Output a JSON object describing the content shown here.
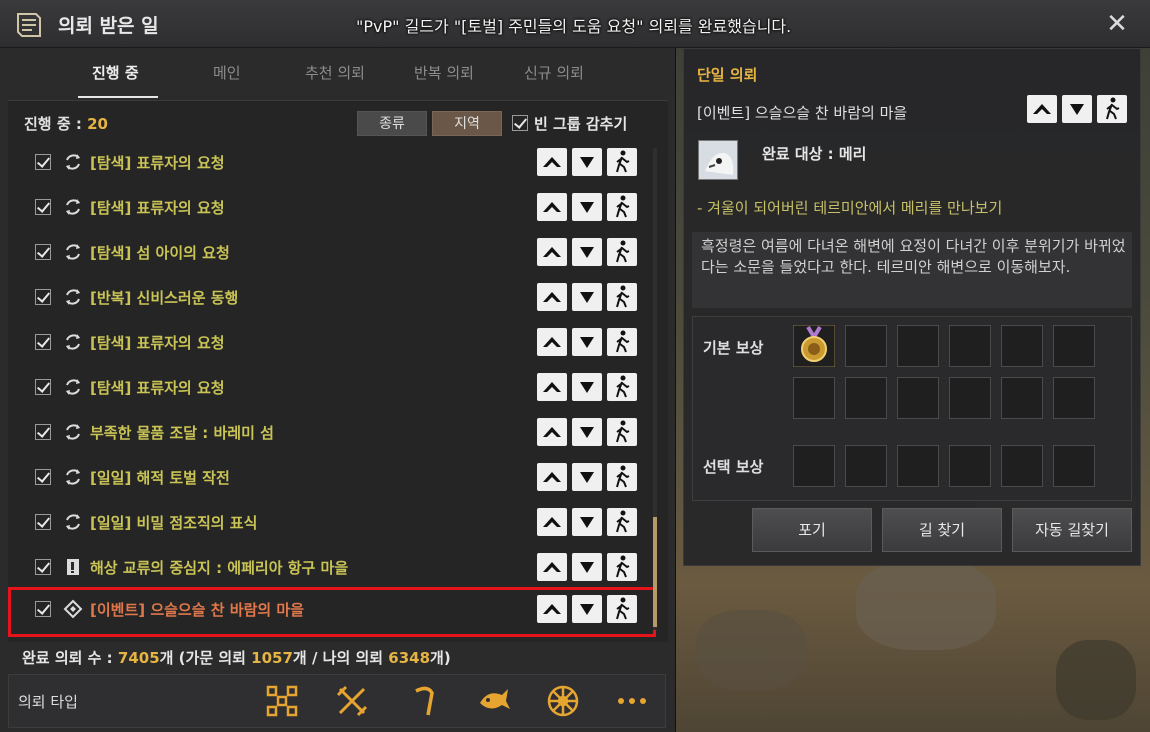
{
  "window": {
    "title": "의뢰 받은 일",
    "notice": "\"PvP\" 길드가 \"[토벌] 주민들의 도움 요청\" 의뢰를 완료했습니다."
  },
  "tabs": [
    {
      "label": "진행 중",
      "active": true
    },
    {
      "label": "메인"
    },
    {
      "label": "추천 의뢰"
    },
    {
      "label": "반복 의뢰"
    },
    {
      "label": "신규 의뢰"
    }
  ],
  "filters": {
    "count_label": "진행 중 : ",
    "count_value": "20",
    "kind_label": "종류",
    "region_label": "지역",
    "hide_empty_label": "빈 그룹 감추기"
  },
  "quests": [
    {
      "name": "[탐색] 표류자의 요청",
      "icon": "repeat-icon"
    },
    {
      "name": "[탐색] 표류자의 요청",
      "icon": "repeat-icon"
    },
    {
      "name": "[탐색] 섬 아이의 요청",
      "icon": "repeat-icon"
    },
    {
      "name": "[반복] 신비스러운 동행",
      "icon": "repeat-icon"
    },
    {
      "name": "[탐색] 표류자의 요청",
      "icon": "repeat-icon"
    },
    {
      "name": "[탐색] 표류자의 요청",
      "icon": "repeat-icon"
    },
    {
      "name": "부족한 물품 조달 : 바레미 섬",
      "icon": "repeat-icon"
    },
    {
      "name": "[일일] 해적 토벌 작전",
      "icon": "repeat-icon"
    },
    {
      "name": "[일일] 비밀 점조직의 표식",
      "icon": "repeat-icon"
    },
    {
      "name": "해상 교류의 중심지 : 에페리아 항구 마을",
      "icon": "scroll-icon"
    },
    {
      "name": "[이벤트] 으슬으슬 찬 바람의 마을",
      "icon": "diamond-icon",
      "event": true
    }
  ],
  "summary": {
    "prefix": "완료 의뢰 수 : ",
    "total": "7405",
    "mid1": "개 (가문 의뢰 ",
    "family": "1057",
    "mid2": "개 / 나의 의뢰 ",
    "mine": "6348",
    "suffix": "개)"
  },
  "type_bar": {
    "label": "의뢰 타입",
    "icons": [
      "all-types-icon",
      "combat-icon",
      "gathering-icon",
      "fishing-icon",
      "trade-icon",
      "more-icon"
    ]
  },
  "detail": {
    "title": "단일 의뢰",
    "quest_name": "[이벤트] 으슬으슬 찬 바람의 마을",
    "target": "완료 대상 : 메리",
    "objective": "- 겨울이 되어버린 테르미안에서 메리를 만나보기",
    "description": "흑정령은 여름에 다녀온 해변에 요정이 다녀간 이후 분위기가 바뀌었다는 소문을 들었다고 한다. 테르미안 해변으로 이동해보자.",
    "basic_reward_label": "기본 보상",
    "choice_reward_label": "선택 보상",
    "buttons": {
      "give_up": "포기",
      "find_path": "길 찾기",
      "auto_path": "자동 길찾기"
    }
  },
  "colors": {
    "quest_text": "#c9c455",
    "event_text": "#e0784a",
    "highlight_border": "#e6141a",
    "accent": "#e6b442"
  }
}
